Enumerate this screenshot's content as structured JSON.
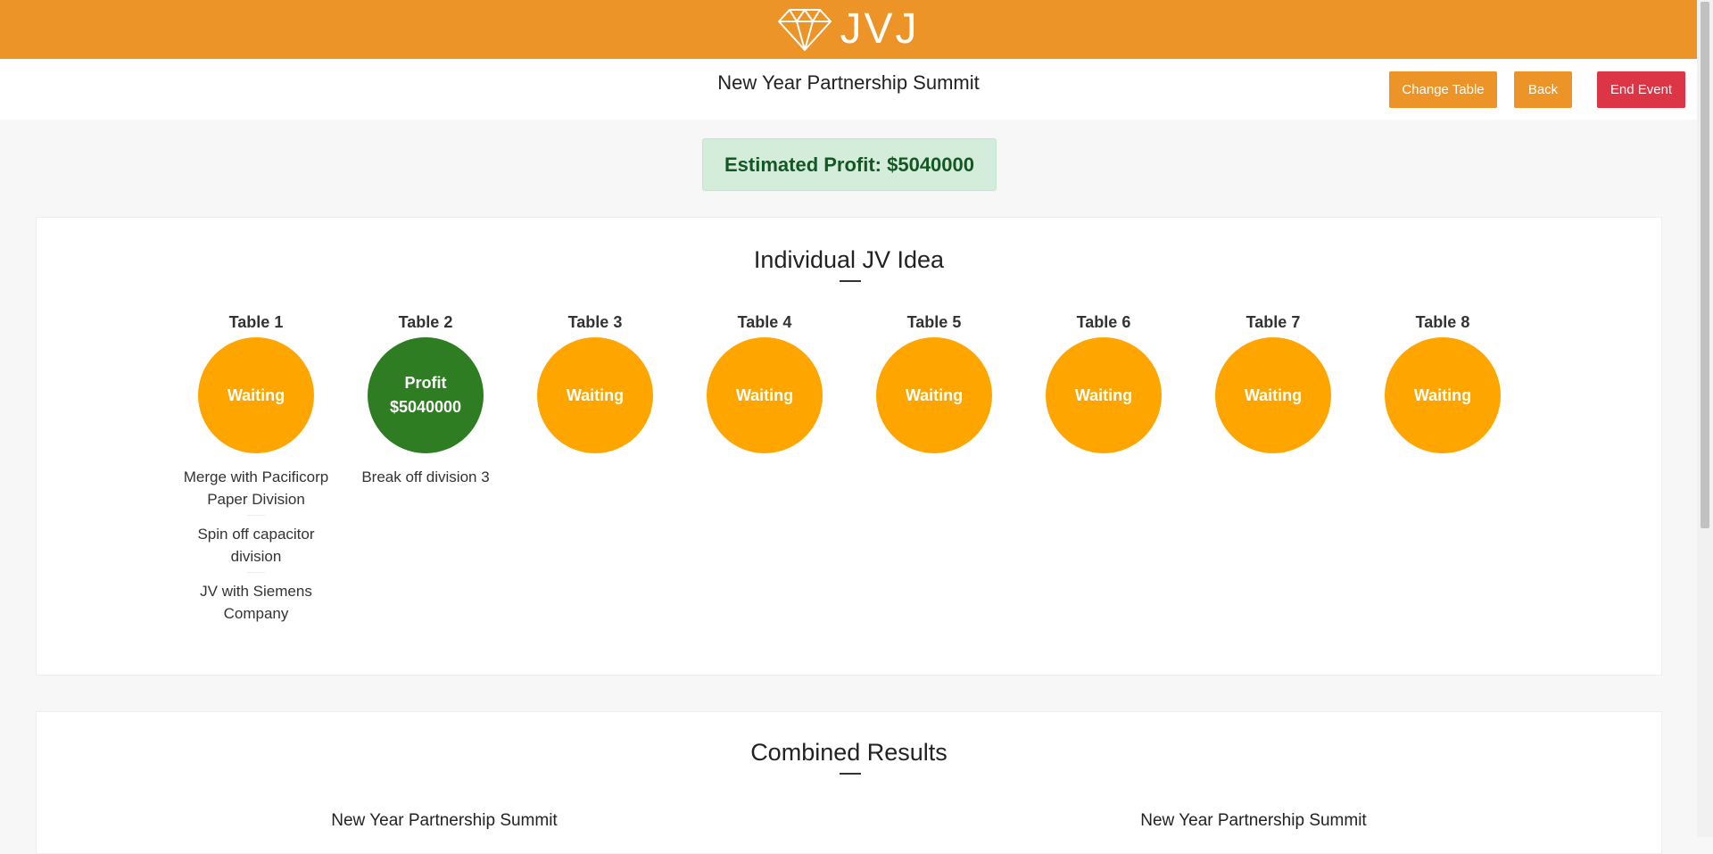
{
  "header": {
    "logo_text": "JVJ",
    "brand_color": "#ec9428"
  },
  "subheader": {
    "event_title": "New Year Partnership Summit",
    "buttons": {
      "change_table": "Change Table",
      "back": "Back",
      "end_event": "End Event"
    }
  },
  "estimated_profit": "Estimated Profit: $5040000",
  "individual": {
    "title": "Individual JV Idea",
    "tables": [
      {
        "name": "Table 1",
        "status": "waiting",
        "lines": [
          "Waiting"
        ],
        "ideas": [
          "Merge with Pacificorp Paper Division",
          "Spin off capacitor division",
          "JV with Siemens Company"
        ]
      },
      {
        "name": "Table 2",
        "status": "profit",
        "lines": [
          "Profit",
          "$5040000"
        ],
        "ideas": [
          "Break off division 3"
        ]
      },
      {
        "name": "Table 3",
        "status": "waiting",
        "lines": [
          "Waiting"
        ],
        "ideas": []
      },
      {
        "name": "Table 4",
        "status": "waiting",
        "lines": [
          "Waiting"
        ],
        "ideas": []
      },
      {
        "name": "Table 5",
        "status": "waiting",
        "lines": [
          "Waiting"
        ],
        "ideas": []
      },
      {
        "name": "Table 6",
        "status": "waiting",
        "lines": [
          "Waiting"
        ],
        "ideas": []
      },
      {
        "name": "Table 7",
        "status": "waiting",
        "lines": [
          "Waiting"
        ],
        "ideas": []
      },
      {
        "name": "Table 8",
        "status": "waiting",
        "lines": [
          "Waiting"
        ],
        "ideas": []
      }
    ]
  },
  "combined": {
    "title": "Combined Results",
    "labels": [
      "New Year Partnership Summit",
      "New Year Partnership Summit"
    ]
  },
  "colors": {
    "waiting": "#ffa500",
    "profit": "#2e7d22",
    "danger": "#dc3545",
    "success_bg": "#d4edda",
    "success_text": "#155724"
  }
}
